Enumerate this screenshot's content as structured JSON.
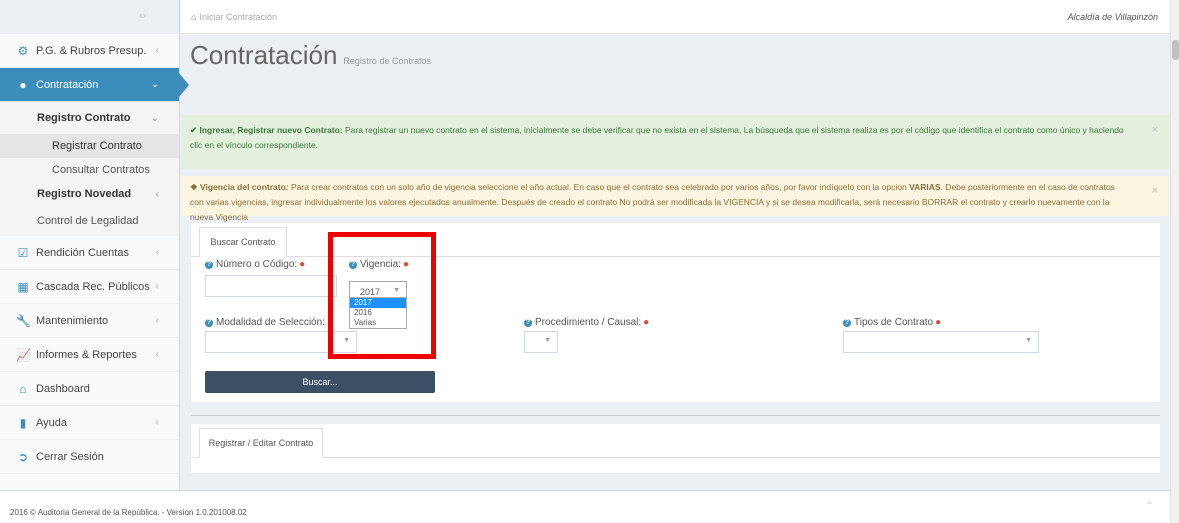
{
  "topbar": {
    "crumb": "Iniciar Contratación",
    "municipality": "Alcaldía de Villapinzón"
  },
  "sidebar": {
    "items": [
      {
        "label": "P.G. & Rubros Presup.",
        "icon": "cogs-icon"
      },
      {
        "label": "Contratación",
        "icon": "circle-icon"
      },
      {
        "label": "Rendición Cuentas",
        "icon": "check-square-icon"
      },
      {
        "label": "Cascada Rec. Públicos",
        "icon": "grid-icon"
      },
      {
        "label": "Mantenimiento",
        "icon": "wrench-icon"
      },
      {
        "label": "Informes & Reportes",
        "icon": "chart-icon"
      },
      {
        "label": "Dashboard",
        "icon": "home-icon"
      },
      {
        "label": "Ayuda",
        "icon": "book-icon"
      },
      {
        "label": "Cerrar Sesión",
        "icon": "logout-icon"
      }
    ],
    "sub": {
      "registro_contrato": "Registro Contrato",
      "registrar_contrato": "Registrar Contrato",
      "consultar_contratos": "Consultar Contratos",
      "registro_novedad": "Registro Novedad",
      "control_legalidad": "Control de Legalidad"
    }
  },
  "page": {
    "title": "Contratación",
    "subtitle": "Registro de Contratos"
  },
  "alerts": {
    "green_title": "Ingresar, Registrar nuevo Contrato:",
    "green_text": "Para registrar un nuevo contrato en el sistema, inicialmente se debe verificar que no exista en el sistema. La búsqueda que el sistema realiza es por el código que identifica el contrato como único y haciendo clic en el vínculo correspondiente.",
    "yellow_title": "Vigencia del contrato:",
    "yellow_text_1": "Para crear contratos con un solo año de vigencia seleccione el año actual. En caso que el contrato sea celebrado por varios años, por favor indíquelo con la opcion",
    "yellow_varias": "VARIAS",
    "yellow_text_2": ". Debe posteriormente en el caso de contratos con varias vigencias, ingresar individualmente los valores ejecutados anualmente. Después de creado el contrato No podrá ser modificada la VIGENCIA y si se desea modificarla, será necesario BORRAR el contrato y crearlo nuevamente con la nueva Vigencia"
  },
  "form": {
    "tab": "Buscar Contrato",
    "numero_label": "Número o Código:",
    "vigencia_label": "Vigencia:",
    "vigencia_value": "2017",
    "vigencia_options": [
      "2017",
      "2016",
      "Varias"
    ],
    "modalidad_label": "Modalidad de Selección:",
    "procedimiento_label": "Procedimiento / Causal:",
    "tipos_label": "Tipos de Contrato",
    "search_button": "Buscar..."
  },
  "panel2": {
    "tab": "Registrar / Editar Contrato"
  },
  "footer": {
    "text": "2016 © Auditoria General de la República. - Version 1.0.201008.02"
  }
}
